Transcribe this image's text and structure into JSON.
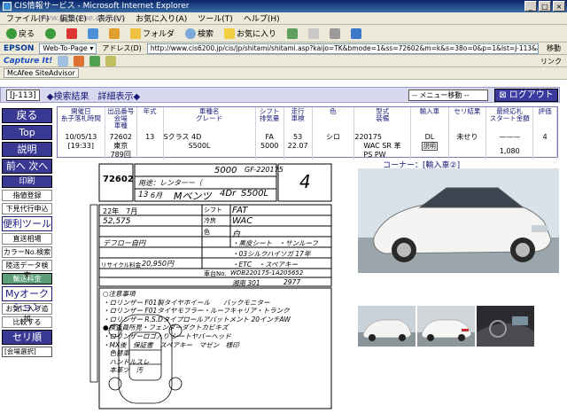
{
  "window": {
    "title": "CIS情報サービス - Microsoft Internet Explorer"
  },
  "menubar": {
    "items": [
      "ファイル(F)",
      "編集(E)",
      "表示(V)",
      "お気に入り(A)",
      "ツール(T)",
      "ヘルプ(H)"
    ],
    "watermark": "www.CEhome.com.cn"
  },
  "toolbar": {
    "back": "戻る",
    "favorites": "フォルダ",
    "search": "検索",
    "favorites_star": "お気に入り"
  },
  "address": {
    "epson": "EPSON",
    "webtopage": "Web-To-Page ▾",
    "label": "アドレス(D)",
    "url": "http://www.cis6200.jp/cis/jp/shitami/shitami.asp?kaijo=TK&bmode=1&ss=72602&m=k&s=38o=0&p=1&lst=J-113&ap=1&pgcd=J-113",
    "go": "移動",
    "links": "リンク"
  },
  "capture": {
    "label": "Capture It!"
  },
  "mcafee": {
    "label": "McAfee SiteAdvisor"
  },
  "header": {
    "id": "[J-113]",
    "title": "◆検索結果　詳細表示◆",
    "menu_select": "-- メニュー移動 --",
    "logout": "ログアウト"
  },
  "sidebar": {
    "back": "戻る",
    "top": "Top",
    "explain": "説明",
    "prev_next": "前へ 次へ",
    "print": "印刷",
    "bid": "指値登録",
    "order": "下見代行申込",
    "tools": "便利ツール",
    "shipping": "直送相場",
    "color": "カラーNo.検索",
    "reprint": "陸送データ検索",
    "delivery": "輸送料金",
    "myauction": "Myオークション",
    "fav_add": "お気に入り追加",
    "compare": "比較する",
    "seri": "セリ順",
    "venue": "[会場選択]"
  },
  "info": {
    "headers": [
      "開催日\n糸子落札時間",
      "出品番号\n会場\n車種",
      "年式",
      "車種名\nグレード",
      "シフト\n排気量",
      "走行\n車検",
      "色",
      "型式\n装備",
      "輸入車",
      "セリ結果",
      "最終応札\nスタート金額",
      "評価"
    ],
    "date": "10/05/13",
    "time": "[19:33]",
    "lot": "72602",
    "venue": "東京",
    "lot_sub": "789回",
    "year": "13",
    "model": "Sクラス 4D",
    "grade": "S500L",
    "shift": "FA",
    "cc": "5000",
    "mileage": "53",
    "inspection": "22.07",
    "color": "シロ",
    "type": "220175",
    "dl": "DL",
    "equip": "WAC SR 革 PS PW",
    "import_btn": "説明",
    "result": "未せり",
    "price_top": "———",
    "price": "1,080",
    "score": "4"
  },
  "corner": {
    "label": "コーナー：[輸入車②]"
  },
  "sheet": {
    "lot": "72602",
    "purpose": "用途：レンターー（",
    "year": "13",
    "month": "6月",
    "maker": "Mベンツ",
    "doors": "4Dr",
    "grade": "S500L",
    "cc": "5000",
    "model_code": "GF-220175",
    "score": "4",
    "shift_label": "シフト",
    "shift": "FAT",
    "aircon_label": "冷房",
    "aircon": "WAC",
    "mileage": "52,575",
    "colour_label": "色",
    "colour": "白",
    "inspection": "22年　7月",
    "kk": "デフロー自円",
    "recycle_label": "リサイクル料金",
    "recycle": "20,950円",
    "vin_label": "車台No.",
    "vin": "WDB220175-1A205652",
    "plate": "湘南 301",
    "plate_no": "2977",
    "notes": [
      "○注意事項",
      "・ロリンザー F01製タイヤホイール　　バックモニター",
      "・ロリンザー F01タイヤモフラー・ルーフキャリア・トランク",
      "・ロリンザー R.S.Dタイプロールアバットメント 20インチAW",
      "●検査員所見・フェンダーダクトカビキズ",
      "・ロリンザーロゴ入り シートヤバーヘッド",
      "・MX後　保証書　スペアキー　マゼン　様印",
      "　色替車",
      "　ハンドルスレ",
      "　本革ツ　汚"
    ],
    "equip_notes": [
      "・黒皮シート　・サンルーフ",
      "・03シルクハイソガ 17年",
      "・ETC　・スペアキー"
    ]
  }
}
